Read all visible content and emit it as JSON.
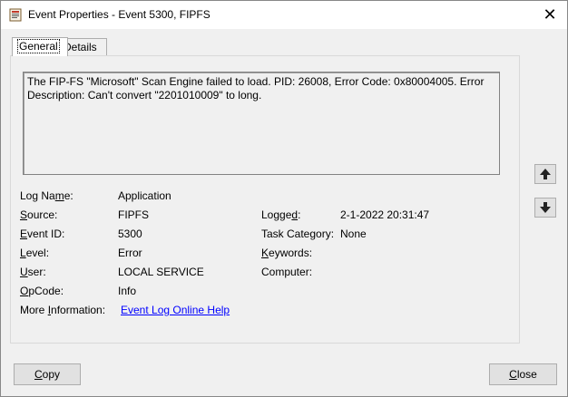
{
  "window": {
    "title": "Event Properties - Event 5300, FIPFS",
    "close_glyph": "✕"
  },
  "tabs": [
    {
      "label": "General",
      "active": true
    },
    {
      "label": "Details",
      "active": false
    }
  ],
  "description": "The FIP-FS \"Microsoft\" Scan Engine failed to load. PID: 26008, Error Code: 0x80004005. Error Description: Can't convert \"2201010009\" to long.",
  "fields": {
    "log_name": {
      "label_pre": "Log Na",
      "label_mn": "m",
      "label_post": "e:",
      "value": "Application"
    },
    "source": {
      "label_pre": "",
      "label_mn": "S",
      "label_post": "ource:",
      "value": "FIPFS"
    },
    "event_id": {
      "label_pre": "",
      "label_mn": "E",
      "label_post": "vent ID:",
      "value": "5300"
    },
    "level": {
      "label_pre": "",
      "label_mn": "L",
      "label_post": "evel:",
      "value": "Error"
    },
    "user": {
      "label_pre": "",
      "label_mn": "U",
      "label_post": "ser:",
      "value": "LOCAL SERVICE"
    },
    "opcode": {
      "label_pre": "",
      "label_mn": "O",
      "label_post": "pCode:",
      "value": "Info"
    },
    "more_info": {
      "label_pre": "More ",
      "label_mn": "I",
      "label_post": "nformation:",
      "value": "Event Log Online Help"
    },
    "logged": {
      "label_pre": "Logge",
      "label_mn": "d",
      "label_post": ":",
      "value": "2-1-2022 20:31:47"
    },
    "task_category": {
      "label_pre": "Task Category:",
      "label_mn": "",
      "label_post": "",
      "value": "None"
    },
    "keywords": {
      "label_pre": "",
      "label_mn": "K",
      "label_post": "eywords:",
      "value": ""
    },
    "computer": {
      "label_pre": "Computer:",
      "label_mn": "",
      "label_post": "",
      "value": ""
    }
  },
  "nav": {
    "up_icon": "arrow-up-icon",
    "down_icon": "arrow-down-icon"
  },
  "buttons": {
    "copy": {
      "mn": "C",
      "rest": "opy"
    },
    "close": {
      "mn": "C",
      "rest": "lose"
    }
  }
}
